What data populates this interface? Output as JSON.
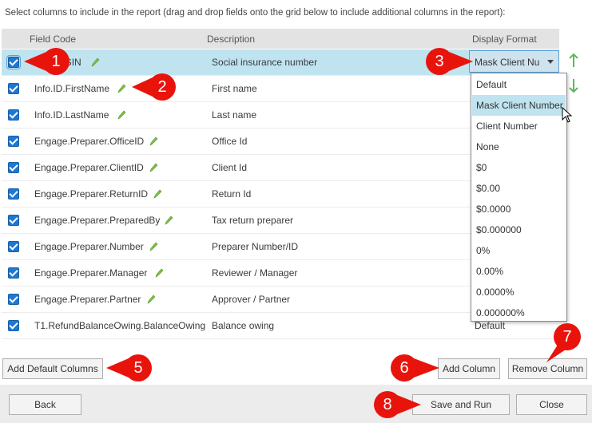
{
  "instructions": "Select columns to include in the report (drag and drop fields onto the grid below to include additional columns in the report):",
  "grid": {
    "headers": {
      "field_code": "Field Code",
      "description": "Description",
      "display_format": "Display Format"
    },
    "rows": [
      {
        "code": "Info.ID.SIN",
        "description": "Social insurance number",
        "format": "Mask Client Nu"
      },
      {
        "code": "Info.ID.FirstName",
        "description": "First name",
        "format": ""
      },
      {
        "code": "Info.ID.LastName",
        "description": "Last name",
        "format": ""
      },
      {
        "code": "Engage.Preparer.OfficeID",
        "description": "Office Id",
        "format": ""
      },
      {
        "code": "Engage.Preparer.ClientID",
        "description": "Client Id",
        "format": ""
      },
      {
        "code": "Engage.Preparer.ReturnID",
        "description": "Return Id",
        "format": ""
      },
      {
        "code": "Engage.Preparer.PreparedBy",
        "description": "Tax return preparer",
        "format": ""
      },
      {
        "code": "Engage.Preparer.Number",
        "description": "Preparer Number/ID",
        "format": ""
      },
      {
        "code": "Engage.Preparer.Manager",
        "description": "Reviewer / Manager",
        "format": ""
      },
      {
        "code": "Engage.Preparer.Partner",
        "description": "Approver / Partner",
        "format": ""
      },
      {
        "code": "T1.RefundBalanceOwing.BalanceOwing",
        "description": "Balance owing",
        "format": "Default"
      }
    ]
  },
  "format_dropdown": {
    "selected": "Mask Client Nu",
    "options": [
      "Default",
      "Mask Client Number",
      "Client Number",
      "None",
      "$0",
      "$0.00",
      "$0.0000",
      "$0.000000",
      "0%",
      "0.00%",
      "0.0000%",
      "0.000000%"
    ],
    "highlighted": "Mask Client Number"
  },
  "buttons": {
    "add_default_columns": "Add Default Columns",
    "add_column": "Add Column",
    "remove_column": "Remove Column",
    "back": "Back",
    "save_and_run": "Save and Run",
    "close": "Close"
  },
  "callouts": [
    "1",
    "2",
    "3",
    "5",
    "6",
    "7",
    "8"
  ],
  "colors": {
    "selected_row": "#bfe4f0",
    "checkbox": "#1e78d2",
    "callout": "#e8140c",
    "arrow": "#5cb85c",
    "pencil": "#7cc242"
  }
}
